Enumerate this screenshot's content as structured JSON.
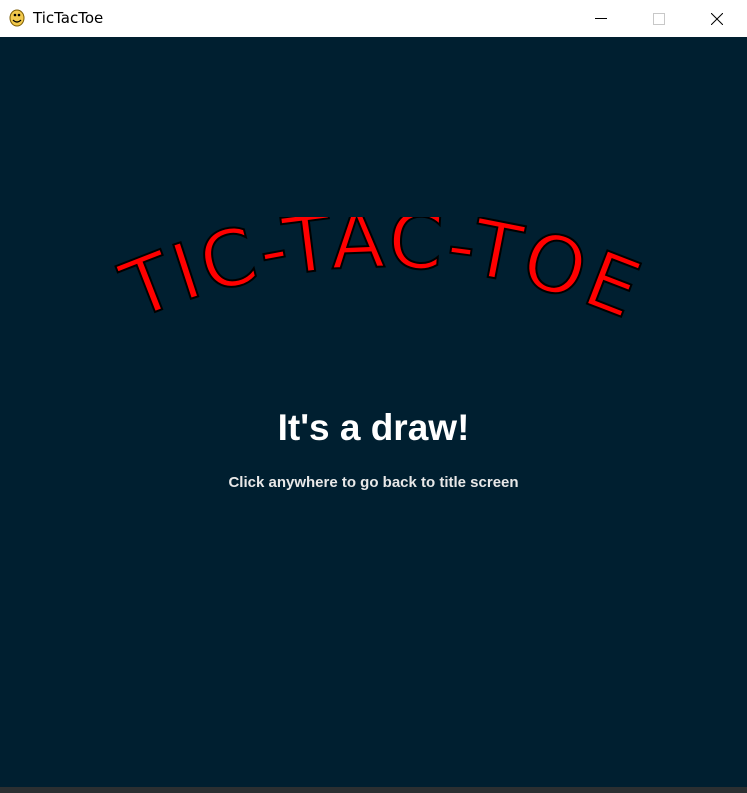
{
  "window": {
    "title": "TicTacToe",
    "icon": "python-snake-icon",
    "controls": [
      "minimize-icon",
      "maximize-icon",
      "close-icon"
    ]
  },
  "game": {
    "logo_text": "TIC-TAC-TOE",
    "result_text": "It's a draw!",
    "hint_text": "Click anywhere to go back to title screen"
  },
  "colors": {
    "background": "#001f30",
    "logo": "#ff0000",
    "logo_outline": "#000000",
    "text": "#ffffff"
  }
}
